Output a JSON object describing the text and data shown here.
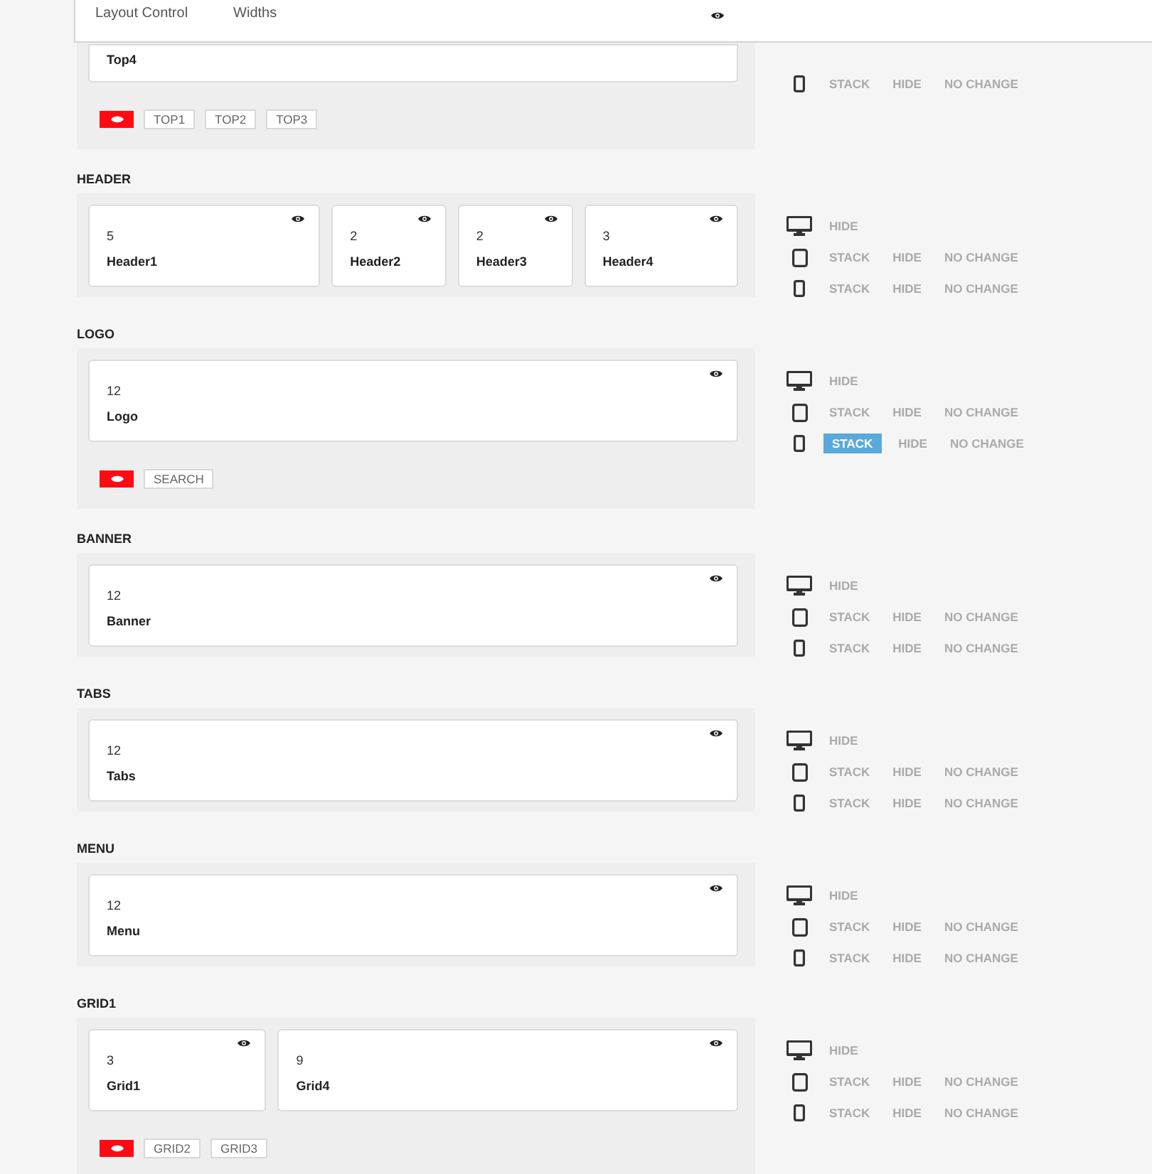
{
  "header": {
    "items": [
      "Layout Control",
      "Widths"
    ]
  },
  "sections": [
    {
      "cards": [
        {
          "name": "Top4"
        }
      ],
      "chips": [
        "TOP1",
        "TOP2",
        "TOP3"
      ],
      "devices": [
        {
          "kind": "phone",
          "options": [
            {
              "label": "STACK",
              "selected": false
            },
            {
              "label": "HIDE",
              "selected": false
            },
            {
              "label": "NO CHANGE",
              "selected": false
            }
          ]
        }
      ]
    },
    {
      "title": "HEADER",
      "cards": [
        {
          "span": "5",
          "name": "Header1"
        },
        {
          "span": "2",
          "name": "Header2"
        },
        {
          "span": "2",
          "name": "Header3"
        },
        {
          "span": "3",
          "name": "Header4"
        }
      ],
      "devices": [
        {
          "kind": "desktop",
          "options": [
            {
              "label": "HIDE",
              "selected": false
            }
          ]
        },
        {
          "kind": "tablet",
          "options": [
            {
              "label": "STACK",
              "selected": false
            },
            {
              "label": "HIDE",
              "selected": false
            },
            {
              "label": "NO CHANGE",
              "selected": false
            }
          ]
        },
        {
          "kind": "phone",
          "options": [
            {
              "label": "STACK",
              "selected": false
            },
            {
              "label": "HIDE",
              "selected": false
            },
            {
              "label": "NO CHANGE",
              "selected": false
            }
          ]
        }
      ]
    },
    {
      "title": "LOGO",
      "cards": [
        {
          "span": "12",
          "name": "Logo"
        }
      ],
      "chips": [
        "SEARCH"
      ],
      "devices": [
        {
          "kind": "desktop",
          "options": [
            {
              "label": "HIDE",
              "selected": false
            }
          ]
        },
        {
          "kind": "tablet",
          "options": [
            {
              "label": "STACK",
              "selected": false
            },
            {
              "label": "HIDE",
              "selected": false
            },
            {
              "label": "NO CHANGE",
              "selected": false
            }
          ]
        },
        {
          "kind": "phone",
          "options": [
            {
              "label": "STACK",
              "selected": true
            },
            {
              "label": "HIDE",
              "selected": false
            },
            {
              "label": "NO CHANGE",
              "selected": false
            }
          ]
        }
      ]
    },
    {
      "title": "BANNER",
      "cards": [
        {
          "span": "12",
          "name": "Banner"
        }
      ],
      "devices": [
        {
          "kind": "desktop",
          "options": [
            {
              "label": "HIDE",
              "selected": false
            }
          ]
        },
        {
          "kind": "tablet",
          "options": [
            {
              "label": "STACK",
              "selected": false
            },
            {
              "label": "HIDE",
              "selected": false
            },
            {
              "label": "NO CHANGE",
              "selected": false
            }
          ]
        },
        {
          "kind": "phone",
          "options": [
            {
              "label": "STACK",
              "selected": false
            },
            {
              "label": "HIDE",
              "selected": false
            },
            {
              "label": "NO CHANGE",
              "selected": false
            }
          ]
        }
      ]
    },
    {
      "title": "TABS",
      "cards": [
        {
          "span": "12",
          "name": "Tabs"
        }
      ],
      "devices": [
        {
          "kind": "desktop",
          "options": [
            {
              "label": "HIDE",
              "selected": false
            }
          ]
        },
        {
          "kind": "tablet",
          "options": [
            {
              "label": "STACK",
              "selected": false
            },
            {
              "label": "HIDE",
              "selected": false
            },
            {
              "label": "NO CHANGE",
              "selected": false
            }
          ]
        },
        {
          "kind": "phone",
          "options": [
            {
              "label": "STACK",
              "selected": false
            },
            {
              "label": "HIDE",
              "selected": false
            },
            {
              "label": "NO CHANGE",
              "selected": false
            }
          ]
        }
      ]
    },
    {
      "title": "MENU",
      "cards": [
        {
          "span": "12",
          "name": "Menu"
        }
      ],
      "devices": [
        {
          "kind": "desktop",
          "options": [
            {
              "label": "HIDE",
              "selected": false
            }
          ]
        },
        {
          "kind": "tablet",
          "options": [
            {
              "label": "STACK",
              "selected": false
            },
            {
              "label": "HIDE",
              "selected": false
            },
            {
              "label": "NO CHANGE",
              "selected": false
            }
          ]
        },
        {
          "kind": "phone",
          "options": [
            {
              "label": "STACK",
              "selected": false
            },
            {
              "label": "HIDE",
              "selected": false
            },
            {
              "label": "NO CHANGE",
              "selected": false
            }
          ]
        }
      ]
    },
    {
      "title": "GRID1",
      "cards": [
        {
          "span": "3",
          "name": "Grid1"
        },
        {
          "span": "9",
          "name": "Grid4"
        }
      ],
      "chips": [
        "GRID2",
        "GRID3"
      ],
      "devices": [
        {
          "kind": "desktop",
          "options": [
            {
              "label": "HIDE",
              "selected": false
            }
          ]
        },
        {
          "kind": "tablet",
          "options": [
            {
              "label": "STACK",
              "selected": false
            },
            {
              "label": "HIDE",
              "selected": false
            },
            {
              "label": "NO CHANGE",
              "selected": false
            }
          ]
        },
        {
          "kind": "phone",
          "options": [
            {
              "label": "STACK",
              "selected": false
            },
            {
              "label": "HIDE",
              "selected": false
            },
            {
              "label": "NO CHANGE",
              "selected": false
            }
          ]
        }
      ]
    }
  ]
}
